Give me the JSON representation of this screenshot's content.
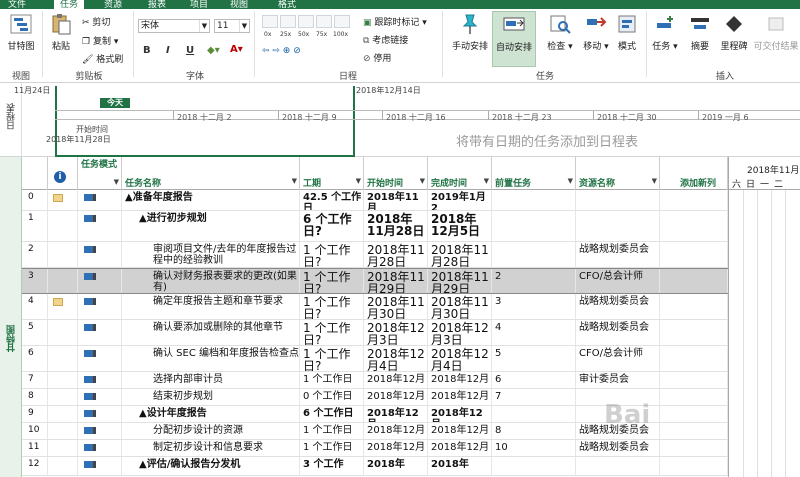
{
  "tabs": [
    {
      "label": "文件",
      "active": false
    },
    {
      "label": "任务",
      "active": true
    },
    {
      "label": "资源",
      "active": false
    },
    {
      "label": "报表",
      "active": false
    },
    {
      "label": "项目",
      "active": false
    },
    {
      "label": "视图",
      "active": false
    },
    {
      "label": "格式",
      "active": false
    }
  ],
  "ribbon": {
    "view_group": {
      "gantt_label": "甘特图",
      "group": "视图"
    },
    "clipboard": {
      "paste": "粘贴",
      "cut": "剪切",
      "copy": "复制",
      "format_painter": "格式刷",
      "group": "剪贴板"
    },
    "font": {
      "name": "宋体",
      "size": "11",
      "bold": "B",
      "italic": "I",
      "underline": "U",
      "group": "字体"
    },
    "schedule": {
      "pcts": [
        "0x",
        "25x",
        "50x",
        "75x",
        "100x"
      ],
      "track": "跟踪时标记",
      "respect_links": "考虑链接",
      "deactivate": "停用",
      "group": "日程"
    },
    "tasks": {
      "manual": "手动安排",
      "auto": "自动安排",
      "inspect": "检查",
      "move": "移动",
      "mode": "模式",
      "group": "任务"
    },
    "insert": {
      "task": "任务",
      "summary": "摘要",
      "milestone": "里程碑",
      "deliverable": "可交付结果",
      "group": "插入"
    }
  },
  "timeline": {
    "side_label": "日程表",
    "today": "今天",
    "start_label": "开始时间",
    "start_date": "2018年11月28日",
    "date_left": "11月24日",
    "date_right": "2018年12月14日",
    "ticks": [
      "2018 十二月 2",
      "2018 十二月 9",
      "2018 十二月 16",
      "2018 十二月 23",
      "2018 十二月 30",
      "2019 一月 6"
    ],
    "placeholder": "将带有日期的任务添加到日程表"
  },
  "gantt": {
    "side_label": "甘特图",
    "columns": {
      "info": "i",
      "mode": "任务模式",
      "name": "任务名称",
      "duration": "工期",
      "start": "开始时间",
      "finish": "完成时间",
      "pred": "前置任务",
      "resource": "资源名称",
      "add": "添加新列"
    },
    "chart_date": "2018年11月2",
    "chart_days": [
      "六",
      "日",
      "一",
      "二"
    ],
    "rows": [
      {
        "id": "0",
        "name": "▲准备年度报告",
        "duration": "42.5 个工作日",
        "start": "2018年11月",
        "finish": "2019年1月2",
        "pred": "",
        "res": "",
        "bold": true,
        "note": true,
        "level": 0
      },
      {
        "id": "1",
        "name": "▲进行初步规划",
        "duration": "6 个工作日?",
        "start": "2018年11月28日",
        "finish": "2018年12月5日",
        "pred": "",
        "res": "",
        "bold": true,
        "note": false,
        "level": 1
      },
      {
        "id": "2",
        "name": "审阅项目文件/去年的年度报告过程中的经验教训",
        "duration": "1 个工作日?",
        "start": "2018年11月28日",
        "finish": "2018年11月28日",
        "pred": "",
        "res": "战略规划委员会",
        "bold": false,
        "note": false,
        "level": 2
      },
      {
        "id": "3",
        "name": "确认对财务报表要求的更改(如果有)",
        "duration": "1 个工作日?",
        "start": "2018年11月29日",
        "finish": "2018年11月29日",
        "pred": "2",
        "res": "CFO/总会计师",
        "bold": false,
        "note": false,
        "level": 2,
        "selected": true
      },
      {
        "id": "4",
        "name": "确定年度报告主题和章节要求",
        "duration": "1 个工作日?",
        "start": "2018年11月30日",
        "finish": "2018年11月30日",
        "pred": "3",
        "res": "战略规划委员会",
        "bold": false,
        "note": true,
        "level": 2
      },
      {
        "id": "5",
        "name": "确认要添加或删除的其他章节",
        "duration": "1 个工作日?",
        "start": "2018年12月3日",
        "finish": "2018年12月3日",
        "pred": "4",
        "res": "战略规划委员会",
        "bold": false,
        "note": false,
        "level": 2
      },
      {
        "id": "6",
        "name": "确认 SEC 编档和年度报告检查点",
        "duration": "1 个工作日?",
        "start": "2018年12月4日",
        "finish": "2018年12月4日",
        "pred": "5",
        "res": "CFO/总会计师",
        "bold": false,
        "note": false,
        "level": 2
      },
      {
        "id": "7",
        "name": "选择内部审计员",
        "duration": "1 个工作日",
        "start": "2018年12月",
        "finish": "2018年12月",
        "pred": "6",
        "res": "审计委员会",
        "bold": false,
        "note": false,
        "level": 2
      },
      {
        "id": "8",
        "name": "结束初步规划",
        "duration": "0 个工作日",
        "start": "2018年12月",
        "finish": "2018年12月",
        "pred": "7",
        "res": "",
        "bold": false,
        "note": false,
        "level": 2
      },
      {
        "id": "9",
        "name": "▲设计年度报告",
        "duration": "6 个工作日",
        "start": "2018年12月",
        "finish": "2018年12月",
        "pred": "",
        "res": "",
        "bold": true,
        "note": false,
        "level": 1
      },
      {
        "id": "10",
        "name": "分配初步设计的资源",
        "duration": "1 个工作日",
        "start": "2018年12月",
        "finish": "2018年12月",
        "pred": "8",
        "res": "战略规划委员会",
        "bold": false,
        "note": false,
        "level": 2
      },
      {
        "id": "11",
        "name": "制定初步设计和信息要求",
        "duration": "1 个工作日",
        "start": "2018年12月",
        "finish": "2018年12月",
        "pred": "10",
        "res": "战略规划委员会",
        "bold": false,
        "note": false,
        "level": 2
      },
      {
        "id": "12",
        "name": "▲评估/确认报告分发机",
        "duration": "3 个工作",
        "start": "2018年",
        "finish": "2018年",
        "pred": "",
        "res": "",
        "bold": true,
        "note": false,
        "level": 1
      }
    ]
  },
  "watermark": "Bai",
  "colors": {
    "accent": "#217346",
    "selected_row": "#d1d1d1",
    "auto_highlight": "#cfe3d2"
  }
}
